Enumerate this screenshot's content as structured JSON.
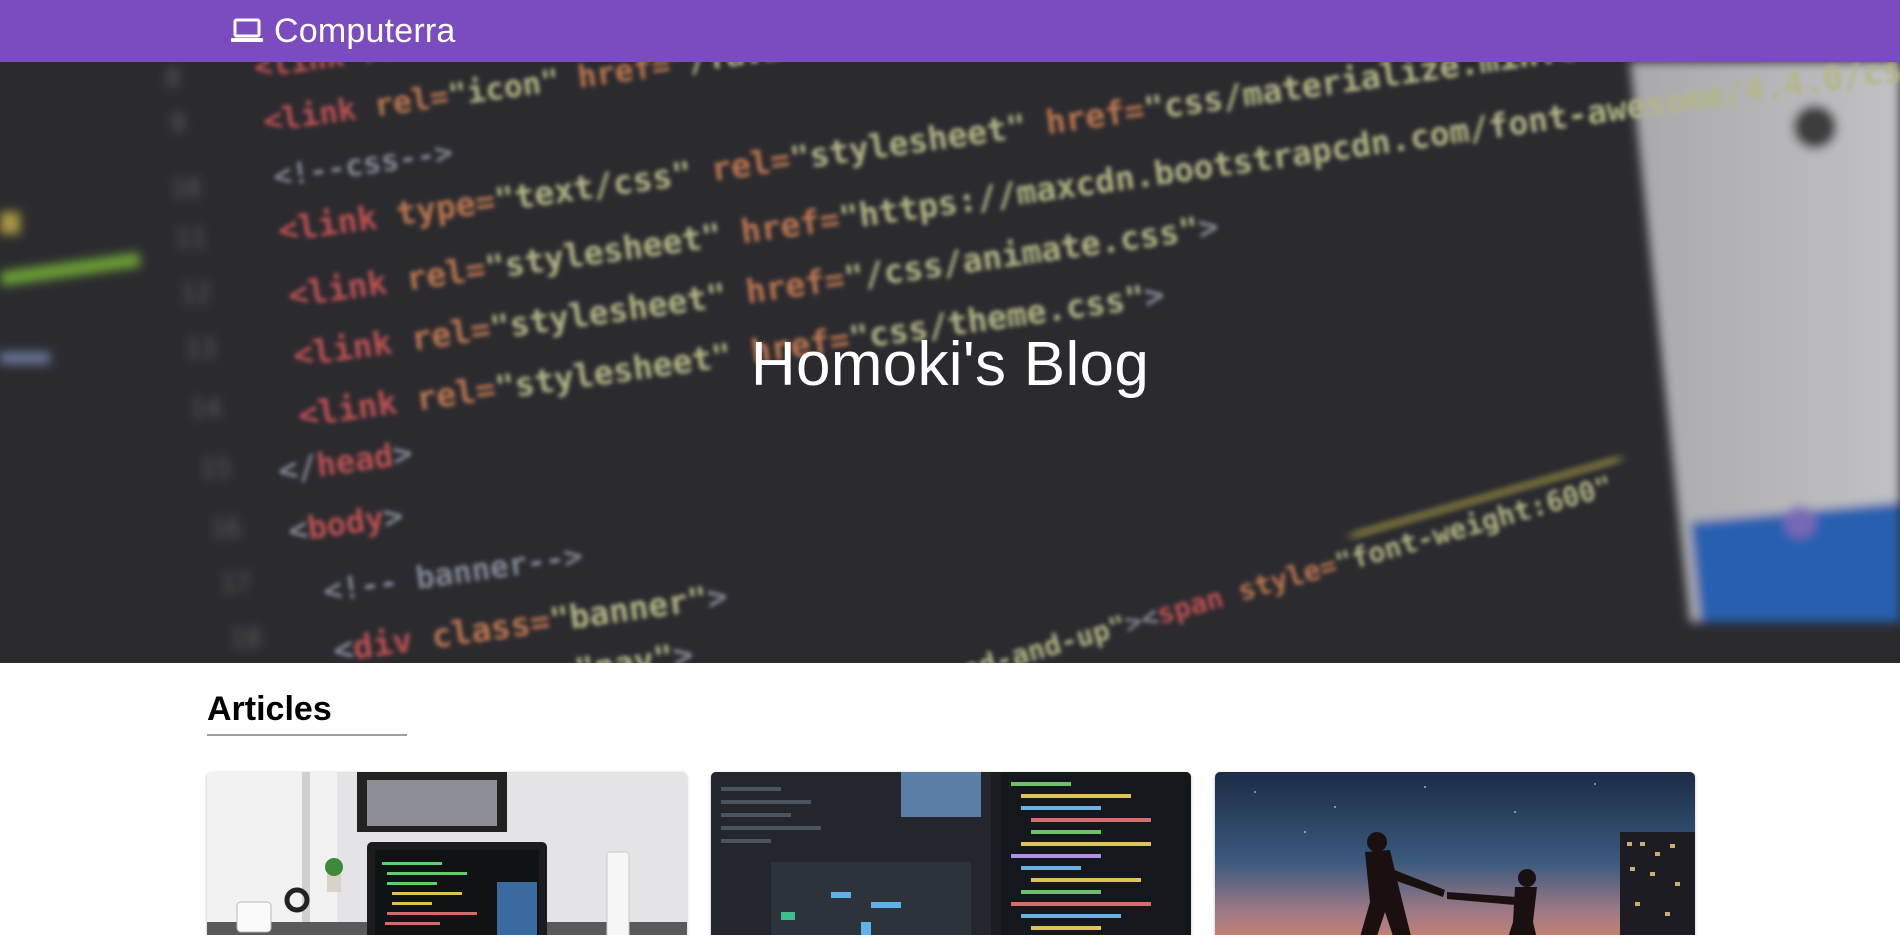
{
  "navbar": {
    "brand_icon": "laptop-icon",
    "brand_text": "Computerra",
    "background": "#7a4cc0"
  },
  "hero": {
    "title": "Homoki's Blog"
  },
  "articles": {
    "heading": "Articles",
    "cards": [
      {
        "image": "laptop-on-desk-image"
      },
      {
        "image": "code-editor-monitors-image"
      },
      {
        "image": "silhouettes-at-dusk-image"
      }
    ]
  }
}
